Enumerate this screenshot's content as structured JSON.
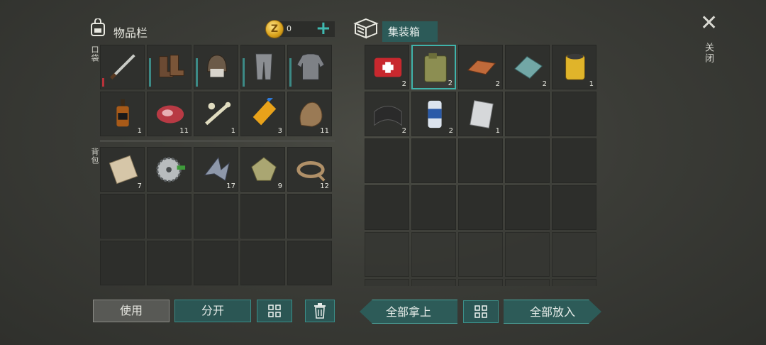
{
  "inventory": {
    "title": "物品栏",
    "coins": "0",
    "coin_letter": "Z",
    "pocket_label": "口袋",
    "backpack_label": "背包",
    "pocket_items": [
      {
        "icon": "machete-icon",
        "count": ""
      },
      {
        "icon": "boots-icon",
        "count": ""
      },
      {
        "icon": "hood-icon",
        "count": ""
      },
      {
        "icon": "pants-icon",
        "count": ""
      },
      {
        "icon": "jacket-icon",
        "count": ""
      },
      {
        "icon": "whiskey-bottle-icon",
        "count": "1"
      },
      {
        "icon": "raw-meat-icon",
        "count": "11"
      },
      {
        "icon": "bones-icon",
        "count": "1"
      },
      {
        "icon": "glue-icon",
        "count": "3"
      },
      {
        "icon": "fur-icon",
        "count": "11"
      }
    ],
    "backpack_items": [
      {
        "icon": "cloth-icon",
        "count": "7"
      },
      {
        "icon": "saw-blade-icon",
        "count": ""
      },
      {
        "icon": "metal-scraps-icon",
        "count": "17"
      },
      {
        "icon": "leather-icon",
        "count": "9"
      },
      {
        "icon": "rope-icon",
        "count": "12"
      }
    ]
  },
  "container": {
    "title": "集装箱",
    "items": [
      {
        "icon": "first-aid-kit-icon",
        "count": "2"
      },
      {
        "icon": "jerry-can-icon",
        "count": "2"
      },
      {
        "icon": "copper-ingot-icon",
        "count": "2"
      },
      {
        "icon": "glass-sheet-icon",
        "count": "2"
      },
      {
        "icon": "oil-filter-icon",
        "count": "1"
      },
      {
        "icon": "rubber-sheet-icon",
        "count": "2"
      },
      {
        "icon": "beer-can-icon",
        "count": "2"
      },
      {
        "icon": "steel-plate-icon",
        "count": "1"
      }
    ]
  },
  "buttons": {
    "use": "使用",
    "split": "分开",
    "take_all": "全部拿上",
    "put_all": "全部放入"
  },
  "close_label": "关闭",
  "close_glyph": "✕"
}
